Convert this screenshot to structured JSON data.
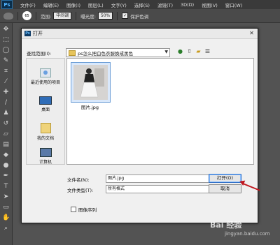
{
  "app": {
    "logo": "Ps",
    "menu": [
      "文件(F)",
      "编辑(E)",
      "图像(I)",
      "图层(L)",
      "文字(Y)",
      "选择(S)",
      "滤镜(T)",
      "3D(D)",
      "视图(V)",
      "窗口(W)"
    ]
  },
  "options": {
    "brush_size": "65",
    "range_label": "范围:",
    "range_value": "中间调",
    "exposure_label": "曝光度:",
    "exposure_value": "50%",
    "protect_tones": "保护色调"
  },
  "dialog": {
    "title": "打开",
    "look_in_label": "查找范围(I):",
    "look_in_value": "ps怎么把白色衣服换成黑色",
    "places": [
      "最近使用的项目",
      "桌面",
      "我的文档",
      "计算机"
    ],
    "file": {
      "name": "图片.jpg"
    },
    "filename_label": "文件名(N):",
    "filename_value": "图片.jpg",
    "filetype_label": "文件类型(T):",
    "filetype_value": "所有格式",
    "open_button": "打开(O)",
    "cancel_button": "取消",
    "image_sequence": "图像序列"
  },
  "watermark": {
    "brand": "Bai 经验",
    "url": "jingyan.baidu.com"
  }
}
